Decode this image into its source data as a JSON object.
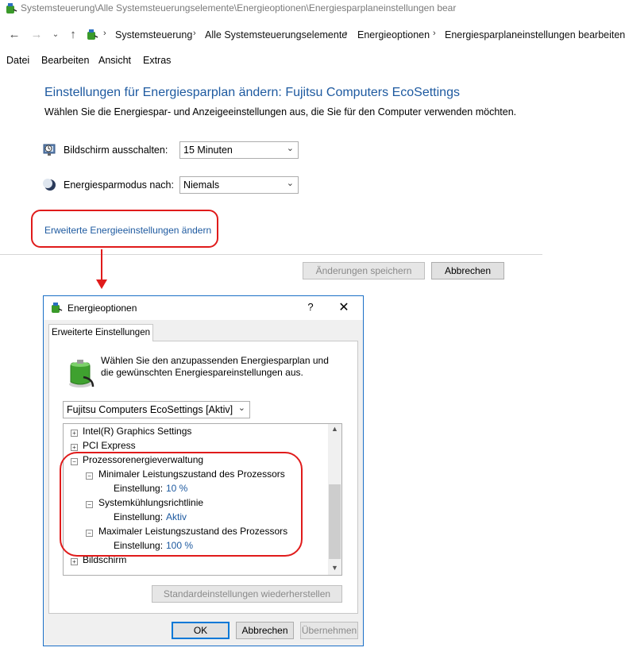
{
  "window": {
    "title": "Systemsteuerung\\Alle Systemsteuerungselemente\\Energieoptionen\\Energiesparplaneinstellungen bear"
  },
  "nav": {
    "back_icon": "back-arrow-icon",
    "forward_icon": "forward-arrow-icon",
    "recent_icon": "chevron-down-icon",
    "up_icon": "up-arrow-icon",
    "breadcrumbs": [
      "Systemsteuerung",
      "Alle Systemsteuerungselemente",
      "Energieoptionen",
      "Energiesparplaneinstellungen bearbeiten"
    ]
  },
  "menubar": [
    "Datei",
    "Bearbeiten",
    "Ansicht",
    "Extras"
  ],
  "main": {
    "heading": "Einstellungen für Energiesparplan ändern: Fujitsu Computers EcoSettings",
    "subtext": "Wählen Sie die Energiespar- und Anzeigeeinstellungen aus, die Sie für den Computer verwenden möchten.",
    "display_off_label": "Bildschirm ausschalten:",
    "display_off_value": "15 Minuten",
    "sleep_label": "Energiesparmodus nach:",
    "sleep_value": "Niemals",
    "advanced_link": "Erweiterte Energieeinstellungen ändern",
    "save_button": "Änderungen speichern",
    "cancel_button": "Abbrechen"
  },
  "dialog": {
    "title": "Energieoptionen",
    "help": "?",
    "close": "✕",
    "tab": "Erweiterte Einstellungen",
    "description": "Wählen Sie den anzupassenden Energiesparplan und die gewünschten Energiespareinstellungen aus.",
    "plan_value": "Fujitsu Computers EcoSettings [Aktiv]",
    "tree": {
      "intel_graphics": "Intel(R) Graphics Settings",
      "pci_express": "PCI Express",
      "processor": "Prozessorenergieverwaltung",
      "min_state": "Minimaler Leistungszustand des Prozessors",
      "setting_label": "Einstellung:",
      "min_value": "10 %",
      "cooling": "Systemkühlungsrichtlinie",
      "cooling_value": "Aktiv",
      "max_state": "Maximaler Leistungszustand des Prozessors",
      "max_value": "100 %",
      "display": "Bildschirm"
    },
    "restore_button": "Standardeinstellungen wiederherstellen",
    "ok_button": "OK",
    "cancel_button": "Abbrechen",
    "apply_button": "Übernehmen"
  },
  "colors": {
    "accent_blue": "#1e5aa0",
    "callout_red": "#e01b1b"
  }
}
